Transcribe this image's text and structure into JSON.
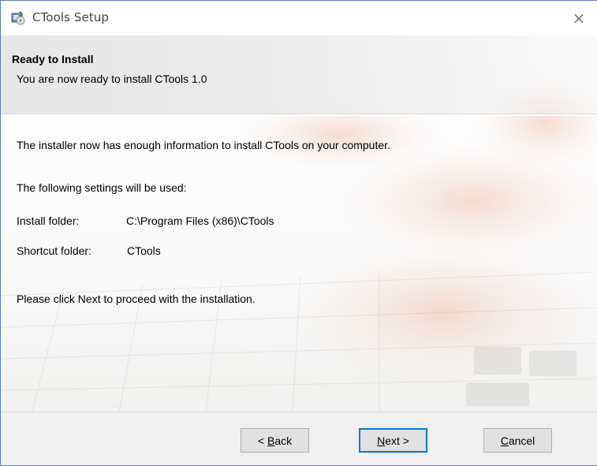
{
  "window": {
    "title": "CTools Setup",
    "close_glyph": "×",
    "icon": "setup-installer-icon"
  },
  "header": {
    "title": "Ready to Install",
    "subtitle": "You are now ready to install CTools 1.0"
  },
  "body": {
    "intro": "The installer now has enough information to install CTools on your computer.",
    "settings_heading": "The following settings will be used:",
    "settings": [
      {
        "label": "Install folder:",
        "value": "C:\\Program Files (x86)\\CTools"
      },
      {
        "label": "Shortcut folder:",
        "value": "CTools"
      }
    ],
    "proceed": "Please click Next to proceed with the installation."
  },
  "buttons": {
    "back": {
      "prefix": "< ",
      "accel": "B",
      "rest": "ack"
    },
    "next": {
      "accel": "N",
      "rest": "ext >"
    },
    "cancel": {
      "accel": "C",
      "rest": "ancel"
    }
  },
  "colors": {
    "focus_border": "#0078d7",
    "footer_bg": "#f0f0f0",
    "button_bg": "#e1e1e1"
  }
}
